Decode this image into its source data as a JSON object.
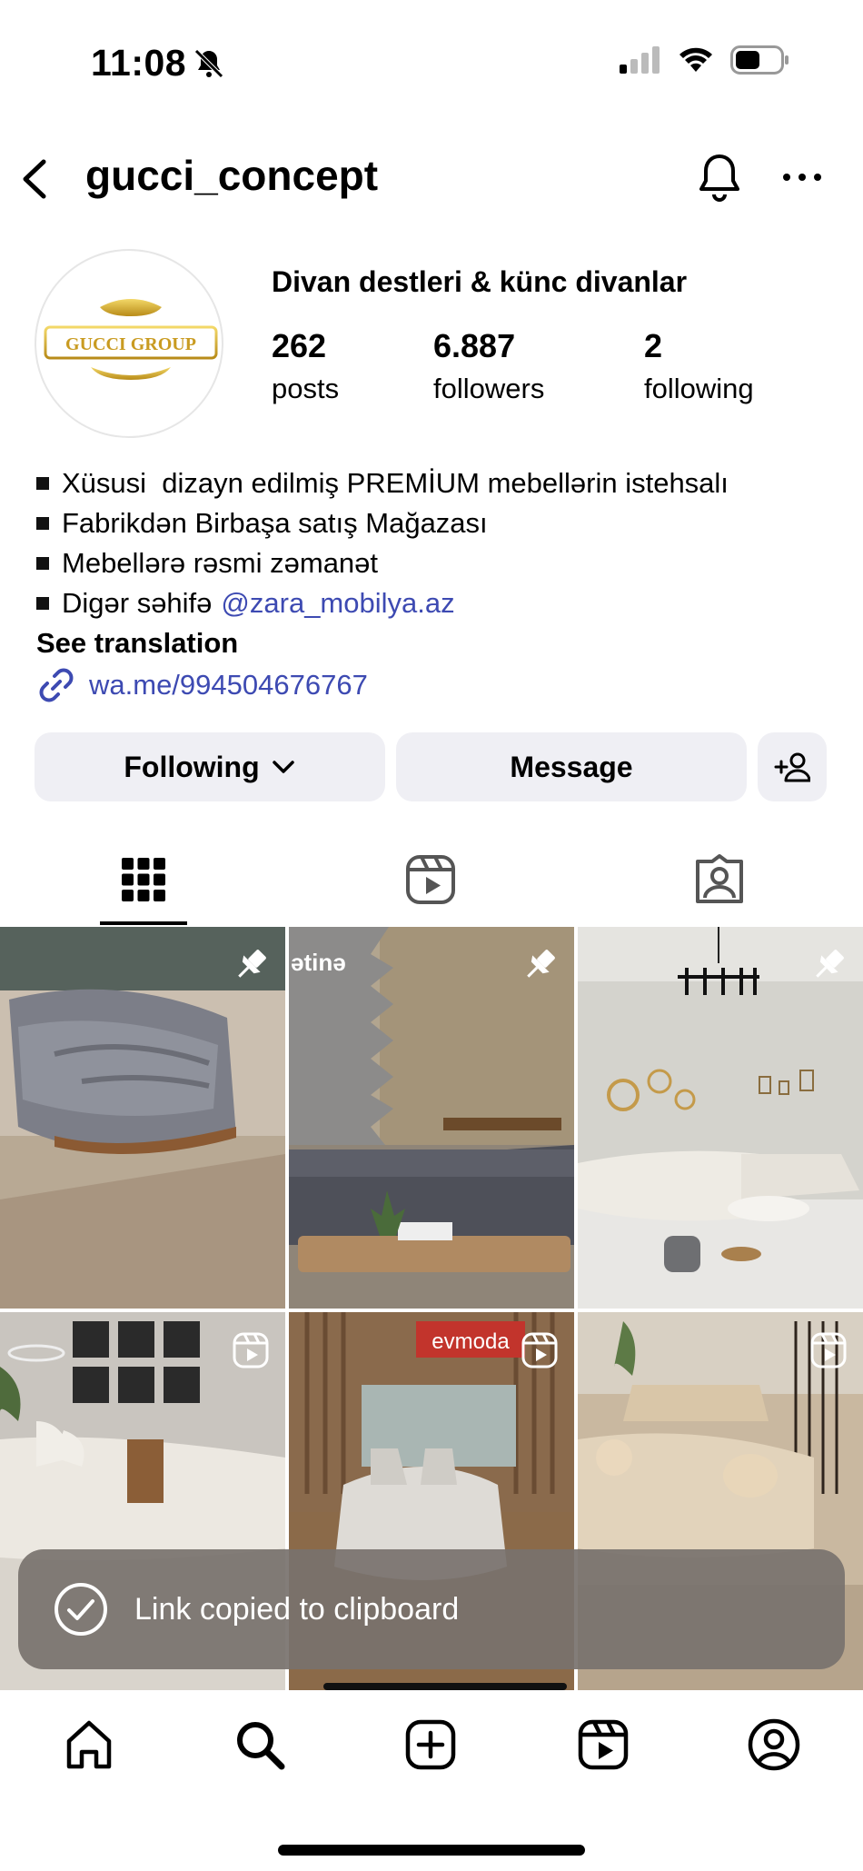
{
  "status_bar": {
    "time": "11:08"
  },
  "header": {
    "username": "gucci_concept"
  },
  "profile": {
    "avatar_logo_text": "GUCCI GROUP",
    "category": "Divan destleri & künc divanlar",
    "stats": [
      {
        "value": "262",
        "label": "posts"
      },
      {
        "value": "6.887",
        "label": "followers"
      },
      {
        "value": "2",
        "label": "following"
      }
    ],
    "bio": [
      "Xüsusi  dizayn edilmiş PREMİUM mebellərin istehsalı",
      "Fabrikdən Birbaşa satış Mağazası",
      "Mebellərə rəsmi zəmanət",
      "Digər səhifə"
    ],
    "bio_mention": "@zara_mobilya.az",
    "see_translation": "See translation",
    "link": "wa.me/994504676767"
  },
  "actions": {
    "following_label": "Following",
    "message_label": "Message"
  },
  "tabs": [
    {
      "icon": "grid-icon",
      "active": true
    },
    {
      "icon": "reels-icon",
      "active": false
    },
    {
      "icon": "tagged-icon",
      "active": false
    }
  ],
  "grid": {
    "posts": [
      {
        "badge": "pin-icon",
        "overlay_text": ""
      },
      {
        "badge": "pin-icon",
        "overlay_text": "ətinə"
      },
      {
        "badge": "pin-icon",
        "overlay_text": ""
      },
      {
        "badge": "reel-icon",
        "overlay_text": ""
      },
      {
        "badge": "reel-icon",
        "overlay_text": "evmoda"
      },
      {
        "badge": "reel-icon",
        "overlay_text": ""
      }
    ]
  },
  "toast": {
    "message": "Link copied to clipboard"
  },
  "bottom_nav": [
    "home-icon",
    "search-icon",
    "create-icon",
    "reels-icon",
    "profile-icon"
  ],
  "colors": {
    "link": "#3d4ab2",
    "button_bg": "#efeff4",
    "toast_bg": "#78726e"
  }
}
